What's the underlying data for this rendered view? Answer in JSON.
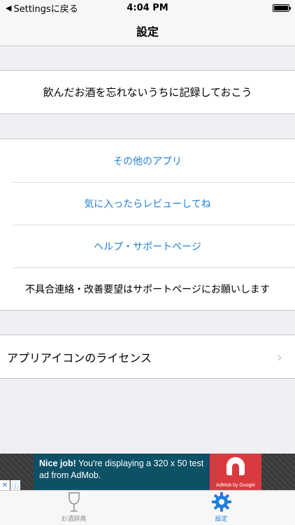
{
  "status_bar": {
    "back_label": "Settingsに戻る",
    "time": "4:04 PM"
  },
  "nav": {
    "title": "設定"
  },
  "sections": [
    {
      "items": [
        {
          "label": "飲んだお酒を忘れないうちに記録しておこう"
        }
      ]
    },
    {
      "items": [
        {
          "label": "その他のアプリ"
        },
        {
          "label": "気に入ったらレビューしてね"
        },
        {
          "label": "ヘルプ・サポートページ"
        },
        {
          "label": "不具合連絡・改善要望はサポートページにお願いします"
        }
      ]
    },
    {
      "items": [
        {
          "label": "アプリアイコンのライセンス"
        }
      ]
    }
  ],
  "ad": {
    "headline": "Nice job!",
    "body": " You're displaying a 320 x 50 test ad from AdMob.",
    "logo_caption": "AdMob by Google"
  },
  "tabs": [
    {
      "label": "お酒辞典",
      "icon": "wine-glass-icon"
    },
    {
      "label": "設定",
      "icon": "gear-icon"
    }
  ],
  "colors": {
    "accent": "#1f7fd9",
    "background": "#efeff4",
    "ad_background": "#0d5166",
    "ad_logo": "#d93a3f"
  }
}
